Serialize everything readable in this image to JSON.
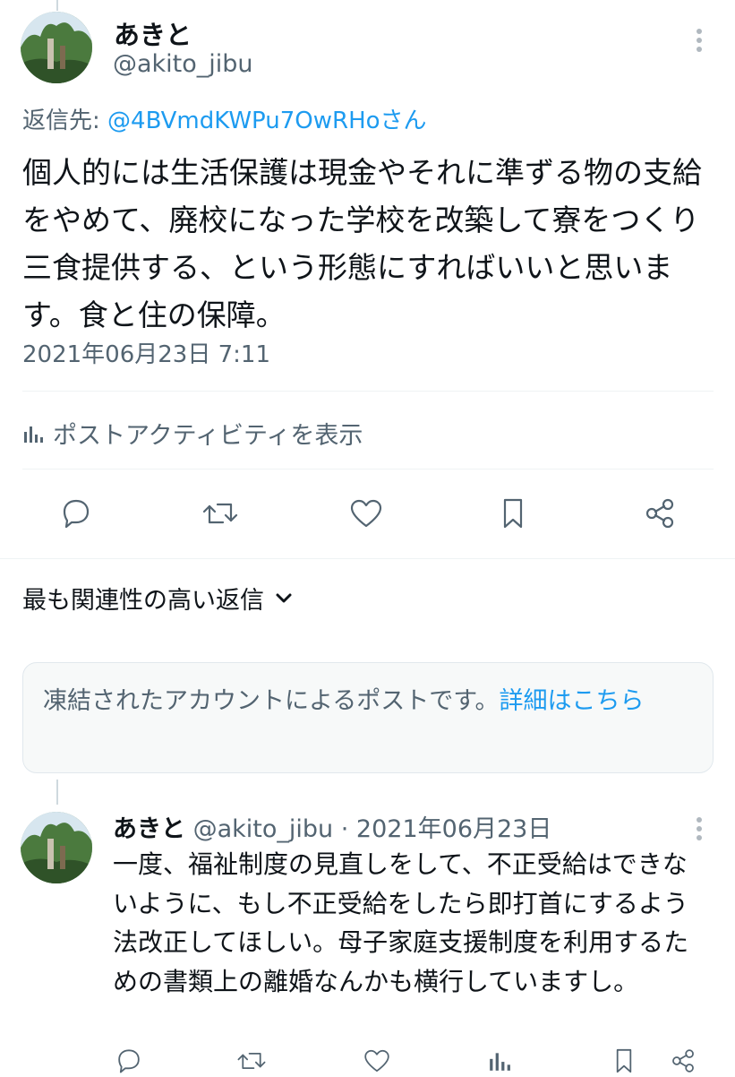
{
  "main_post": {
    "display_name": "あきと",
    "handle": "@akito_jibu",
    "reply_prefix": "返信先: ",
    "reply_to": "@4BVmdKWPu7OwRHoさん",
    "text": "個人的には生活保護は現金やそれに準ずる物の支給をやめて、廃校になった学校を改築して寮をつくり三食提供する、という形態にすればいいと思います。食と住の保障。",
    "timestamp": "2021年06月23日 7:11",
    "activity_label": "ポストアクティビティを表示"
  },
  "replies_header": {
    "sort_label": "最も関連性の高い返信"
  },
  "suspended_notice": {
    "text": "凍結されたアカウントによるポストです。",
    "link_text": "詳細はこちら"
  },
  "reply_post": {
    "display_name": "あきと",
    "handle": "@akito_jibu",
    "separator": "·",
    "date": "2021年06月23日",
    "text": "一度、福祉制度の見直しをして、不正受給はできないように、もし不正受給をしたら即打首にするよう法改正してほしい。母子家庭支援制度を利用するための書類上の離婚なんかも横行していますし。"
  },
  "icons": [
    "reply-icon",
    "repost-icon",
    "like-icon",
    "bookmark-icon",
    "share-icon",
    "analytics-icon",
    "more-icon",
    "chevron-down-icon"
  ],
  "colors": {
    "link": "#1d9bf0",
    "muted": "#536471",
    "text": "#0f1419",
    "notice_bg": "#f7f9f9"
  }
}
